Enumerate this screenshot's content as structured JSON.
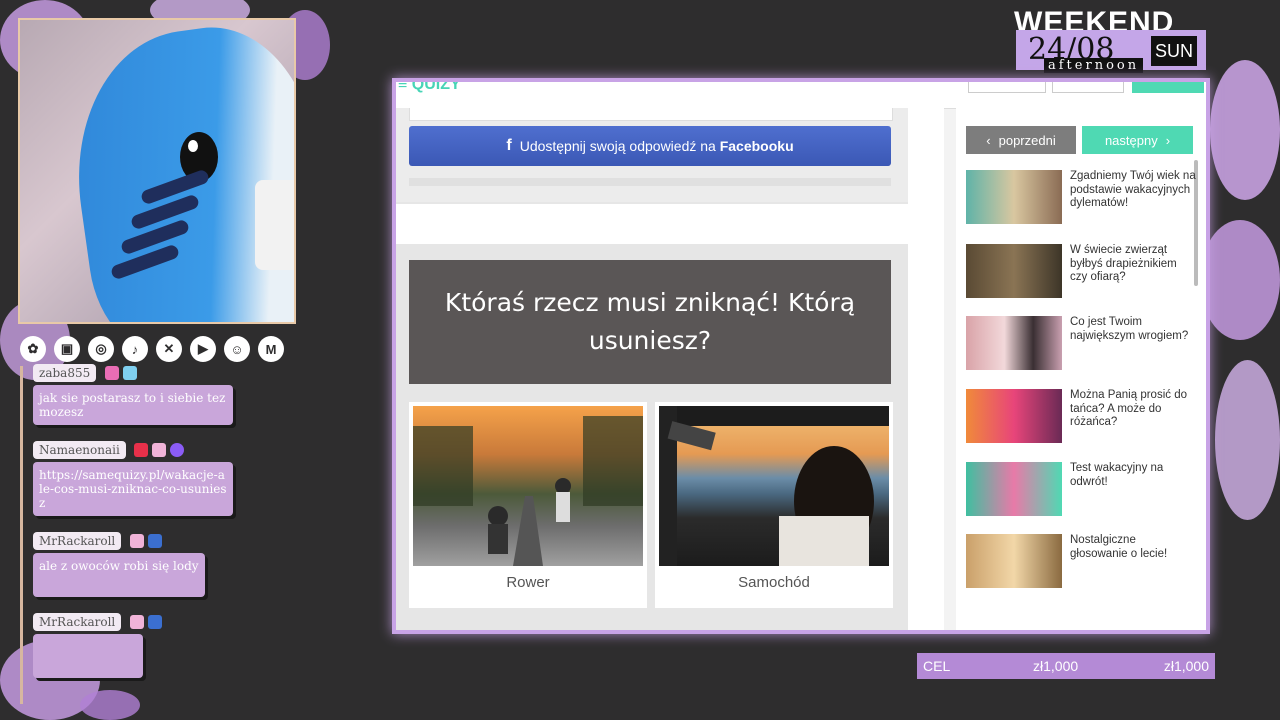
{
  "overlay": {
    "schedule": {
      "top": "WEEKEND",
      "date": "24/08",
      "day": "SUN",
      "sub": "afternoon"
    },
    "goal": {
      "label": "CEL",
      "current": "zł1,000",
      "target": "zł1,000"
    },
    "socials": [
      "pink-logo-icon",
      "twitch-icon",
      "instagram-icon",
      "tiktok-icon",
      "x-icon",
      "youtube-icon",
      "discord-icon",
      "gmail-icon"
    ]
  },
  "chat": {
    "messages": [
      {
        "user": "zaba855",
        "text": "jak sie postarasz to i siebie tez mozesz"
      },
      {
        "user": "Namaenonaii",
        "text": "https://samequizy.pl/wakacje-ale-cos-musi-zniknac-co-usuniesz"
      },
      {
        "user": "MrRackaroll",
        "text": "ale z owoców robi się lody"
      },
      {
        "user": "MrRackaroll",
        "text": ""
      }
    ]
  },
  "quiz": {
    "facebook_button": {
      "pre": "Udostępnij swoją odpowiedź na",
      "bold": "Facebooku"
    },
    "question": "Któraś rzecz musi zniknąć! Którą usuniesz?",
    "options": [
      {
        "label": "Rower"
      },
      {
        "label": "Samochód"
      }
    ]
  },
  "sidebar": {
    "prev": "poprzedni",
    "next": "następny",
    "related": [
      "Zgadniemy Twój wiek na podstawie wakacyjnych dylematów!",
      "W świecie zwierząt byłbyś drapieżnikiem czy ofiarą?",
      "Co jest Twoim największym wrogiem?",
      "Można Panią prosić do tańca? A może do różańca?",
      "Test wakacyjny na odwrót!",
      "Nostalgiczne głosowanie o lecie!"
    ]
  },
  "colors": {
    "accent_purple": "#c8a3e6",
    "facebook_blue": "#3b58b5",
    "next_green": "#4fd9b3",
    "question_bg": "#5a5656"
  }
}
